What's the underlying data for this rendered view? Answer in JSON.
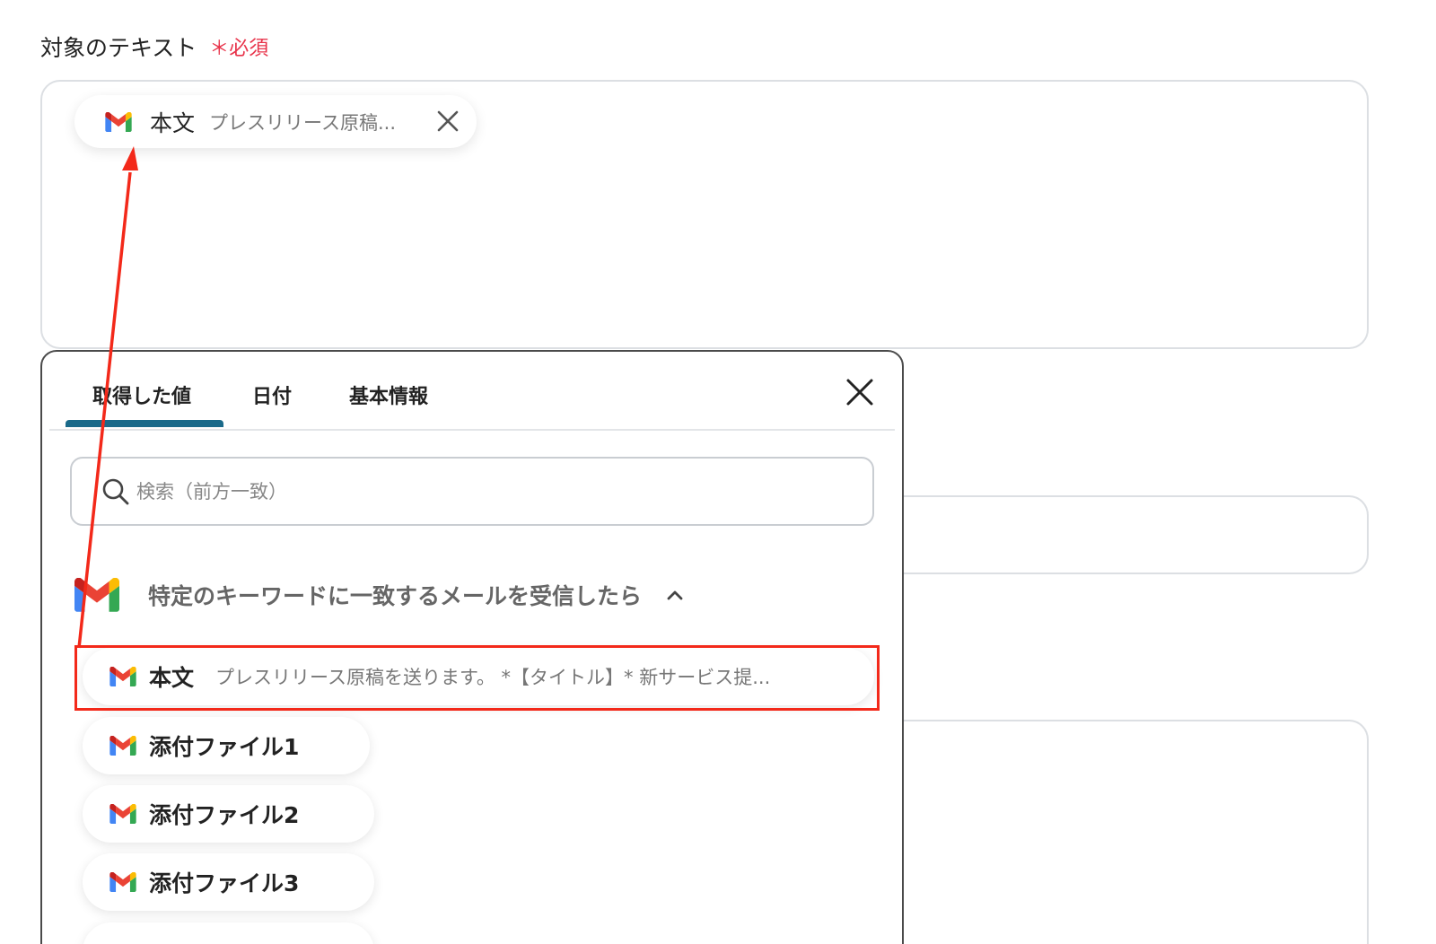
{
  "field": {
    "label": "対象のテキスト",
    "required": "＊必須"
  },
  "chip": {
    "name": "本文",
    "preview": "プレスリリース原稿...",
    "icon": "gmail-icon"
  },
  "popup": {
    "tabs": [
      {
        "label": "取得した値",
        "active": true
      },
      {
        "label": "日付",
        "active": false
      },
      {
        "label": "基本情報",
        "active": false
      }
    ],
    "search_placeholder": "検索（前方一致）",
    "group": {
      "title": "特定のキーワードに一致するメールを受信したら"
    },
    "items": [
      {
        "name": "本文",
        "preview": "プレスリリース原稿を送ります。 *【タイトル】* 新サービス提..."
      },
      {
        "name": "添付ファイル1",
        "preview": ""
      },
      {
        "name": "添付ファイル2",
        "preview": ""
      },
      {
        "name": "添付ファイル3",
        "preview": ""
      }
    ]
  },
  "colors": {
    "accent": "#1a6a8a",
    "required": "#e8334a",
    "annotation": "#f3291a"
  }
}
